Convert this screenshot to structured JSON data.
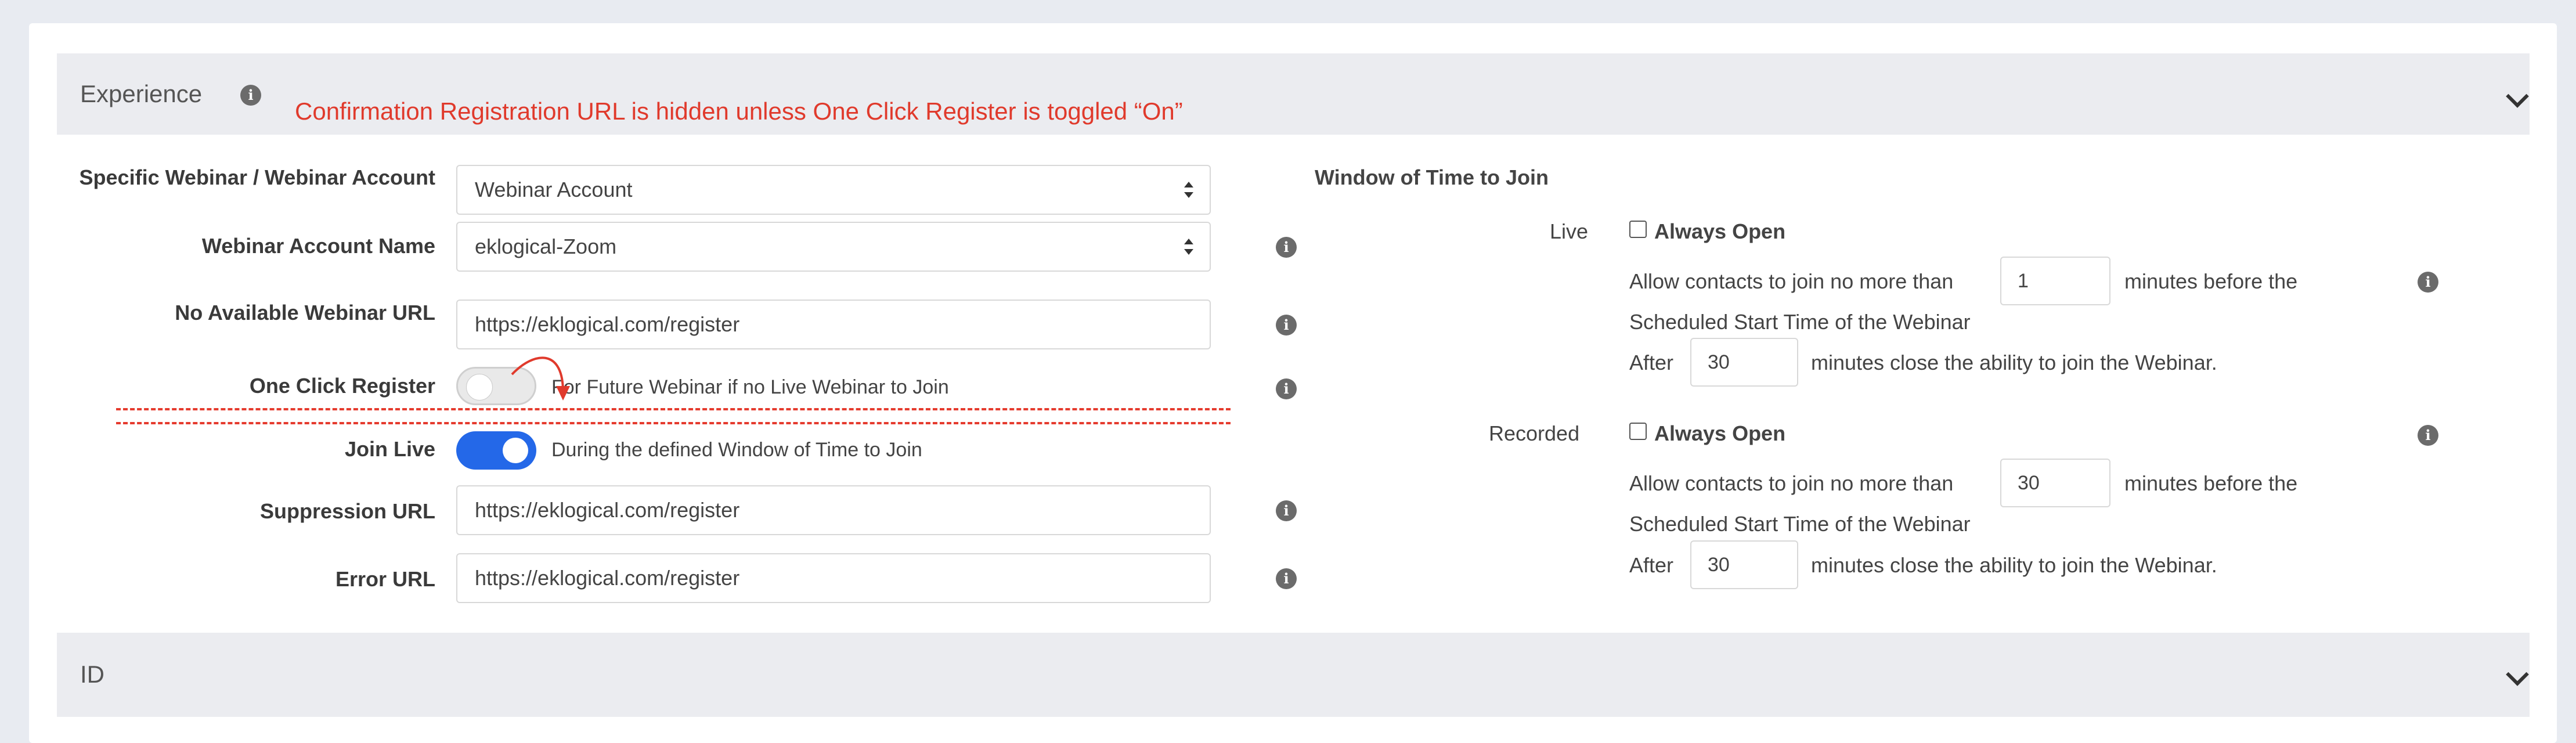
{
  "experience": {
    "title": "Experience",
    "annotation": "Confirmation Registration URL is hidden unless One Click Register is toggled “On”",
    "form": {
      "specific_webinar_label": "Specific Webinar / Webinar Account",
      "specific_webinar_value": "Webinar Account",
      "account_name_label": "Webinar Account Name",
      "account_name_value": "eklogical-Zoom",
      "no_available_url_label": "No Available Webinar URL",
      "no_available_url_value": "https://eklogical.com/register",
      "one_click_label": "One Click Register",
      "one_click_text": "For Future Webinar if no Live Webinar to Join",
      "one_click_state": "off",
      "join_live_label": "Join Live",
      "join_live_text": "During the defined Window of Time to Join",
      "join_live_state": "on",
      "suppression_label": "Suppression URL",
      "suppression_value": "https://eklogical.com/register",
      "error_label": "Error URL",
      "error_value": "https://eklogical.com/register"
    },
    "window": {
      "title": "Window of Time to Join",
      "live": {
        "label": "Live",
        "always_open": "Always Open",
        "allow_prefix": "Allow contacts to join no more than",
        "before_value": "1",
        "before_suffix": "minutes before the",
        "scheduled": "Scheduled Start Time of the Webinar",
        "after_label": "After",
        "after_value": "30",
        "after_suffix": "minutes close the ability to join the Webinar."
      },
      "recorded": {
        "label": "Recorded",
        "always_open": "Always Open",
        "allow_prefix": "Allow contacts to join no more than",
        "before_value": "30",
        "before_suffix": "minutes before the",
        "scheduled": "Scheduled Start Time of the Webinar",
        "after_label": "After",
        "after_value": "30",
        "after_suffix": "minutes close the ability to join the Webinar."
      }
    }
  },
  "id_section": {
    "title": "ID"
  },
  "colors": {
    "accent": "#2468e8",
    "annotation": "#e03a2c",
    "section_bg": "#ebecf0"
  },
  "icons": [
    "info-icon",
    "chevron-down-icon",
    "select-arrows-icon",
    "red-arrow-annotation"
  ]
}
